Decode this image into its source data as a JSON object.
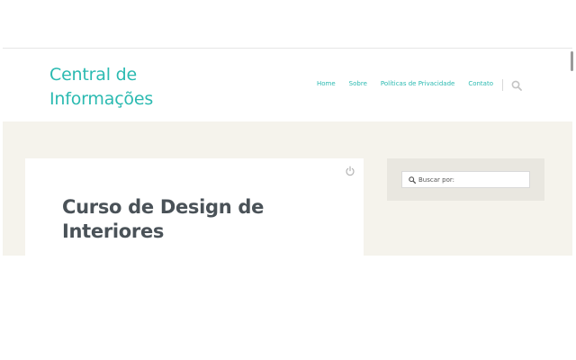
{
  "site": {
    "logo_line1": "Central de",
    "logo_line2": "Informações"
  },
  "nav": {
    "items": [
      {
        "label": "Home"
      },
      {
        "label": "Sobre"
      },
      {
        "label": "Políticas de Privacidade"
      },
      {
        "label": "Contato"
      }
    ],
    "search_icon": "search-icon"
  },
  "post": {
    "title": "Curso de Design de Interiores",
    "icon": "power-icon"
  },
  "sidebar": {
    "search_placeholder": "Buscar por:",
    "icon": "search-icon"
  },
  "colors": {
    "accent": "#2bbab1",
    "page_background": "#f5f3ec",
    "title_text": "#4a5258"
  }
}
